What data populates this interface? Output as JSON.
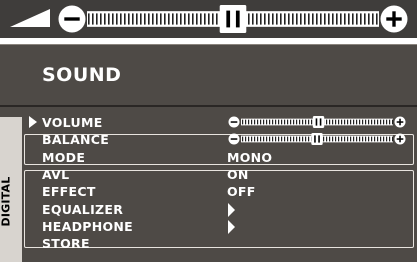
{
  "volume_bar": {
    "level": 0.5
  },
  "sound_menu": {
    "title": "SOUND",
    "side_label": "DIGITAL",
    "items": [
      {
        "label": "VOLUME",
        "type": "slider",
        "level": 0.51,
        "selected": true
      },
      {
        "label": "BALANCE",
        "type": "slider",
        "level": 0.5
      },
      {
        "label": "MODE",
        "type": "value",
        "value": "MONO"
      },
      {
        "label": "AVL",
        "type": "value",
        "value": "ON"
      },
      {
        "label": "EFFECT",
        "type": "value",
        "value": "OFF"
      },
      {
        "label": "EQUALIZER",
        "type": "submenu"
      },
      {
        "label": "HEADPHONE",
        "type": "submenu"
      },
      {
        "label": "STORE",
        "type": "action"
      }
    ]
  },
  "colors": {
    "top_bar": "#3f3d3b",
    "menu_bg": "#4e4a46",
    "text": "#ffffff"
  },
  "icons": {
    "volume": "volume-wedge-icon",
    "minus": "minus-icon",
    "plus": "plus-icon",
    "cursor": "triangle-right-icon",
    "submenu": "triangle-right-icon"
  }
}
